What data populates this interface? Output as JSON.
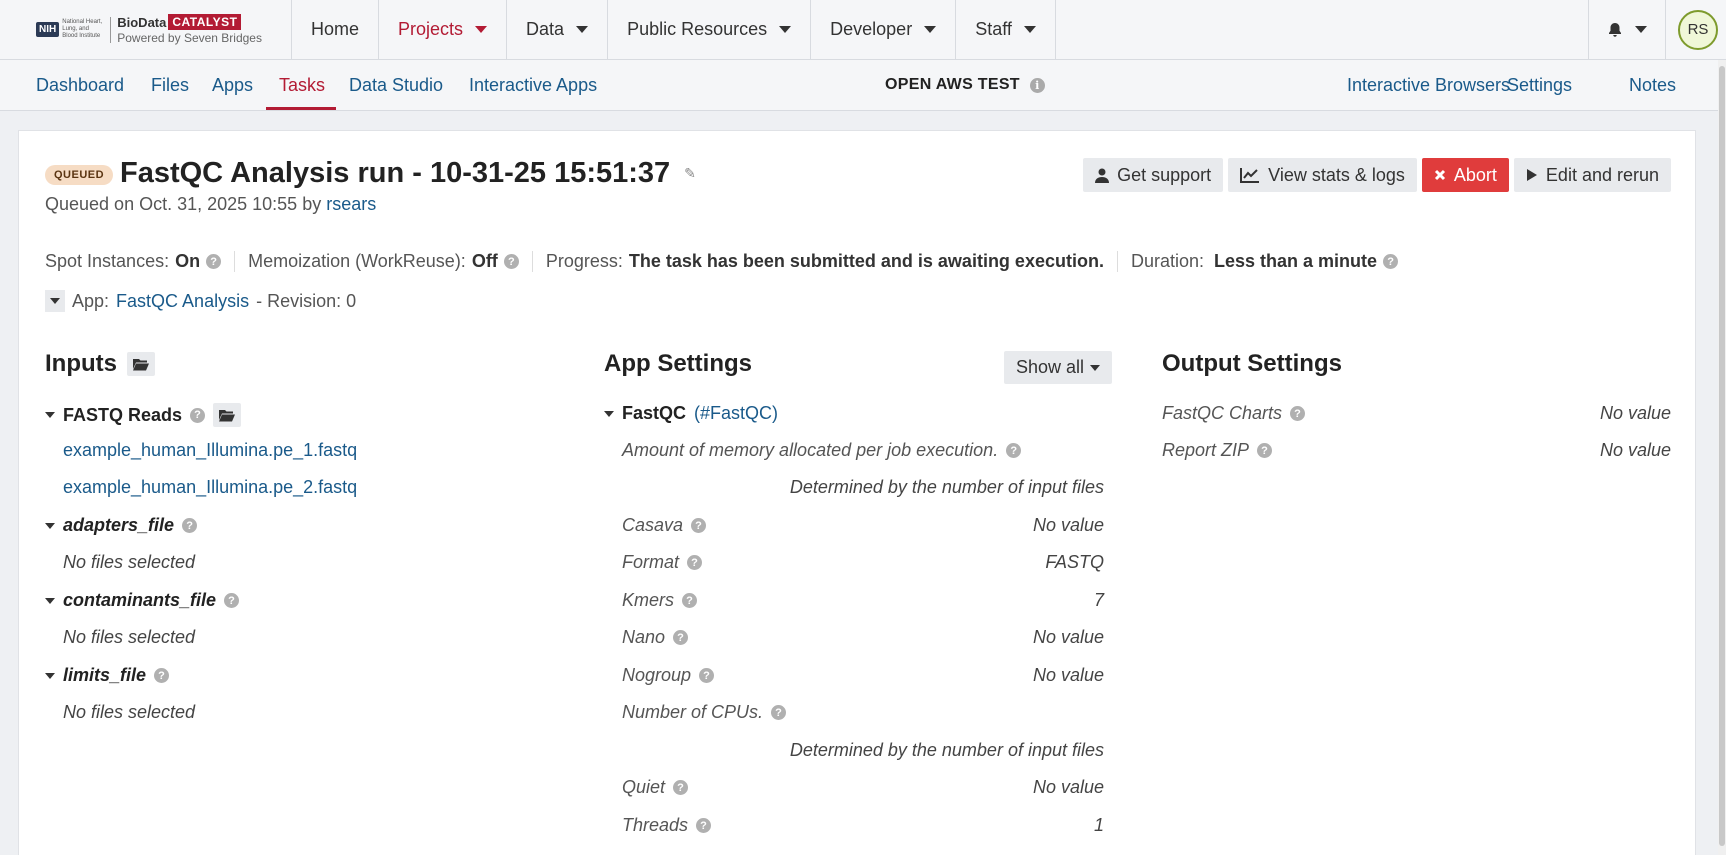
{
  "brand": {
    "nih": "NIH",
    "nih_sub": "National Heart, Lung, and Blood Institute",
    "biodata": "BioData",
    "catalyst": "CATALYST",
    "powered": "Powered by Seven Bridges"
  },
  "topnav": {
    "items": [
      "Home",
      "Projects",
      "Data",
      "Public Resources",
      "Developer",
      "Staff"
    ],
    "active": "Projects",
    "avatar": "RS"
  },
  "subnav": {
    "left": [
      "Dashboard",
      "Files",
      "Apps",
      "Tasks",
      "Data Studio",
      "Interactive Apps"
    ],
    "active": "Tasks",
    "project": "OPEN AWS TEST",
    "right": [
      "Interactive Browsers",
      "Settings",
      "Notes"
    ]
  },
  "task": {
    "status": "QUEUED",
    "title": "FastQC Analysis run - 10-31-25 15:51:37",
    "queued_prefix": "Queued on Oct. 31, 2025 10:55 by ",
    "user": "rsears",
    "spot_label": "Spot Instances:",
    "spot_value": "On",
    "memo_label": "Memoization (WorkReuse):",
    "memo_value": "Off",
    "progress_label": "Progress:",
    "progress_value": "The task has been submitted and is awaiting execution.",
    "duration_label": "Duration:",
    "duration_value": "Less than a minute",
    "app_label": "App:",
    "app_name": "FastQC Analysis",
    "revision": "- Revision: 0"
  },
  "actions": {
    "support": "Get support",
    "stats": "View stats & logs",
    "abort": "Abort",
    "rerun": "Edit and rerun"
  },
  "inputs": {
    "heading": "Inputs",
    "fastq_label": "FASTQ Reads",
    "fastq_files": [
      "example_human_Illumina.pe_1.fastq",
      "example_human_Illumina.pe_2.fastq"
    ],
    "groups": [
      {
        "name": "adapters_file",
        "value": "No files selected"
      },
      {
        "name": "contaminants_file",
        "value": "No files selected"
      },
      {
        "name": "limits_file",
        "value": "No files selected"
      }
    ]
  },
  "app_settings": {
    "heading": "App Settings",
    "show_all": "Show all",
    "tool": "FastQC",
    "tool_id": "(#FastQC)",
    "params": [
      {
        "label": "Amount of memory allocated per job execution.",
        "value": "Determined by the number of input files"
      },
      {
        "label": "Casava",
        "value": "No value"
      },
      {
        "label": "Format",
        "value": "FASTQ"
      },
      {
        "label": "Kmers",
        "value": "7"
      },
      {
        "label": "Nano",
        "value": "No value"
      },
      {
        "label": "Nogroup",
        "value": "No value"
      },
      {
        "label": "Number of CPUs.",
        "value": "Determined by the number of input files"
      },
      {
        "label": "Quiet",
        "value": "No value"
      },
      {
        "label": "Threads",
        "value": "1"
      }
    ]
  },
  "output_settings": {
    "heading": "Output Settings",
    "items": [
      {
        "label": "FastQC Charts",
        "value": "No value"
      },
      {
        "label": "Report ZIP",
        "value": "No value"
      }
    ]
  }
}
